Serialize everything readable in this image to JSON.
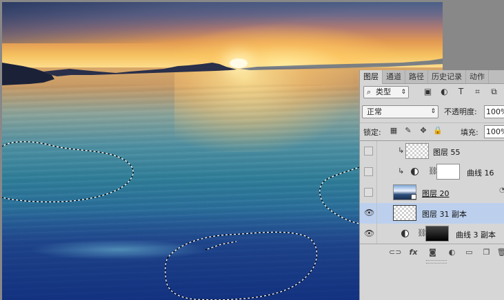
{
  "tabs": [
    "图层",
    "通道",
    "路径",
    "历史记录",
    "动作"
  ],
  "filter": {
    "label": "类型",
    "icons": [
      "image-filter-icon",
      "adjustment-filter-icon",
      "type-filter-icon",
      "shape-filter-icon",
      "smart-object-filter-icon"
    ],
    "glyphs": [
      "▣",
      "◐",
      "T",
      "⌗",
      "⧉"
    ]
  },
  "blend_mode": "正常",
  "opacity_label": "不透明度:",
  "opacity_value": "100%",
  "lock_label": "锁定:",
  "lock_icons": [
    "lock-transparent-icon",
    "lock-paint-icon",
    "lock-move-icon",
    "lock-all-icon"
  ],
  "lock_glyphs": [
    "▦",
    "✎",
    "✥",
    "🔒"
  ],
  "fill_label": "填充:",
  "fill_value": "100%",
  "layers": [
    {
      "name": "图层 55",
      "visible": false,
      "clipped": true,
      "type": "pixel",
      "selected": false
    },
    {
      "name": "曲线 16",
      "visible": false,
      "clipped": true,
      "type": "curves-white-mask",
      "selected": false
    },
    {
      "name": "图层 20",
      "visible": false,
      "clipped": false,
      "type": "smart-object",
      "selected": false
    },
    {
      "name": "图层 31 副本",
      "visible": true,
      "clipped": false,
      "type": "pixel",
      "selected": true
    },
    {
      "name": "曲线 3 副本",
      "visible": true,
      "clipped": false,
      "type": "curves-black-mask",
      "selected": false
    }
  ],
  "footer_icons": [
    "link-layers-icon",
    "fx-icon",
    "add-mask-icon",
    "new-adjustment-icon",
    "new-group-icon",
    "new-layer-icon",
    "delete-layer-icon"
  ],
  "footer_glyphs": [
    "⊂⊃",
    "fx",
    "◙",
    "◐",
    "▭",
    "❐",
    "🗑"
  ]
}
